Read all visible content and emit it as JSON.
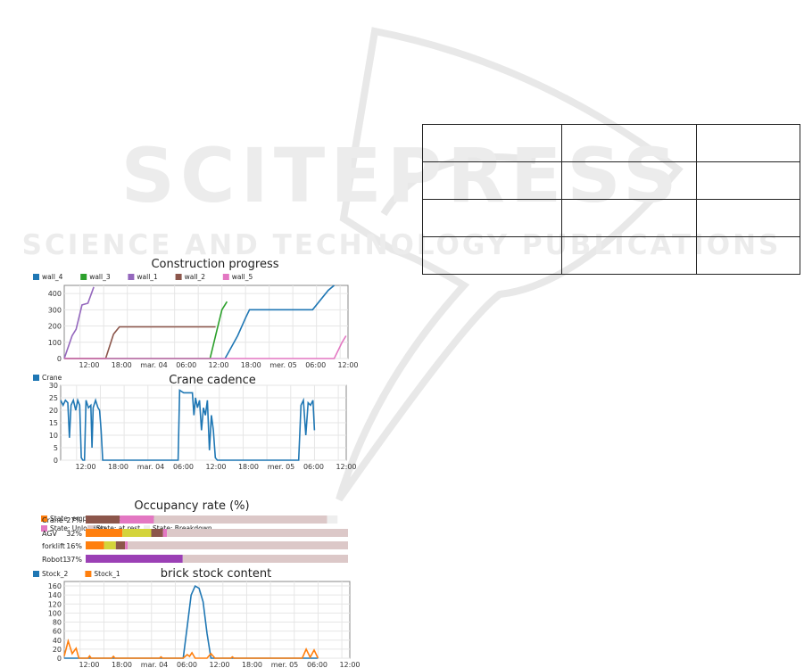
{
  "watermark": {
    "line1": "SCITEPRESS",
    "line2": "SCIENCE AND TECHNOLOGY PUBLICATIONS"
  },
  "empty_table": {
    "rows": 4,
    "cols": 3
  },
  "colors": {
    "wall_4": "#1f77b4",
    "wall_3": "#2ca02c",
    "wall_1": "#9467bd",
    "wall_2": "#8c564b",
    "wall_5": "#e377c2",
    "crane": "#1f77b4",
    "stock_2": "#1f77b4",
    "stock_1": "#ff7f0e"
  },
  "chart_data": [
    {
      "type": "line",
      "title": "Construction progress",
      "x_ticks": [
        "12:00",
        "18:00",
        "mar. 04",
        "06:00",
        "12:00",
        "18:00",
        "mer. 05",
        "06:00",
        "12:00"
      ],
      "ylim": [
        0,
        450
      ],
      "y_ticks": [
        0,
        100,
        200,
        300,
        400
      ],
      "series": [
        {
          "name": "wall_4",
          "points": [
            [
              0,
              0
            ],
            [
              40.8,
              0
            ],
            [
              41.5,
              30
            ],
            [
              44,
              140
            ],
            [
              46,
              250
            ],
            [
              47,
              300
            ],
            [
              63,
              300
            ],
            [
              67,
              420
            ],
            [
              68.5,
              450
            ]
          ]
        },
        {
          "name": "wall_3",
          "points": [
            [
              0,
              0
            ],
            [
              37,
              0
            ],
            [
              38.5,
              150
            ],
            [
              40,
              300
            ],
            [
              41.3,
              350
            ]
          ]
        },
        {
          "name": "wall_1",
          "points": [
            [
              0,
              0
            ],
            [
              2,
              140
            ],
            [
              3,
              180
            ],
            [
              4.5,
              330
            ],
            [
              6,
              340
            ],
            [
              7.5,
              440
            ]
          ]
        },
        {
          "name": "wall_2",
          "points": [
            [
              0,
              0
            ],
            [
              10.5,
              0
            ],
            [
              12.5,
              150
            ],
            [
              14,
              195
            ],
            [
              38.4,
              195
            ]
          ]
        },
        {
          "name": "wall_5",
          "points": [
            [
              0,
              0
            ],
            [
              68.5,
              0
            ],
            [
              70.5,
              100
            ],
            [
              71.5,
              140
            ]
          ]
        }
      ],
      "grid": true,
      "legend": "top-left"
    },
    {
      "type": "line",
      "title": "Crane cadence",
      "x_ticks": [
        "12:00",
        "18:00",
        "mar. 04",
        "06:00",
        "12:00",
        "18:00",
        "mer. 05",
        "06:00",
        "12:00"
      ],
      "ylim": [
        0,
        30
      ],
      "y_ticks": [
        0,
        5,
        10,
        15,
        20,
        25,
        30
      ],
      "series": [
        {
          "name": "Crane",
          "points": [
            [
              0,
              24
            ],
            [
              0.6,
              22
            ],
            [
              1.2,
              24
            ],
            [
              1.8,
              23
            ],
            [
              2.2,
              9
            ],
            [
              2.6,
              22
            ],
            [
              3.2,
              24
            ],
            [
              3.8,
              20
            ],
            [
              4.3,
              24
            ],
            [
              4.8,
              22
            ],
            [
              5.2,
              1
            ],
            [
              5.6,
              0
            ],
            [
              6,
              0
            ],
            [
              6.4,
              24
            ],
            [
              7,
              21
            ],
            [
              7.6,
              22
            ],
            [
              7.9,
              5
            ],
            [
              8.2,
              21
            ],
            [
              8.8,
              24
            ],
            [
              9.4,
              21
            ],
            [
              9.8,
              20
            ],
            [
              10.2,
              12
            ],
            [
              10.6,
              0
            ],
            [
              11.2,
              0
            ],
            [
              29.6,
              0
            ],
            [
              30,
              28
            ],
            [
              31,
              27
            ],
            [
              32,
              27
            ],
            [
              33.2,
              27
            ],
            [
              33.6,
              18
            ],
            [
              34,
              25
            ],
            [
              34.5,
              21
            ],
            [
              35,
              24
            ],
            [
              35.5,
              12
            ],
            [
              36,
              21
            ],
            [
              36.5,
              18
            ],
            [
              37,
              24
            ],
            [
              37.5,
              4
            ],
            [
              38,
              18
            ],
            [
              38.5,
              12
            ],
            [
              39,
              1
            ],
            [
              39.5,
              0
            ],
            [
              60,
              0
            ],
            [
              60.6,
              22
            ],
            [
              61.2,
              24
            ],
            [
              61.8,
              10
            ],
            [
              62.4,
              23
            ],
            [
              63,
              22
            ],
            [
              63.6,
              24
            ],
            [
              64,
              12
            ]
          ]
        }
      ],
      "grid": true,
      "legend": "top-left"
    },
    {
      "type": "bar",
      "stacked": true,
      "orientation": "horizontal",
      "title": "Occupancy rate (%)",
      "legend": "top-left",
      "states": [
        {
          "name": "State: empty travel",
          "color": "#ff7f0e"
        },
        {
          "name": "State: charged travel",
          "color": "#d4d43b"
        },
        {
          "name": "State: Loading",
          "color": "#8c564b"
        },
        {
          "name": "State: Surface finish",
          "color": "#9b40b5"
        },
        {
          "name": "State: Unloading",
          "color": "#e377c2"
        },
        {
          "name": "State: at rest",
          "color": "#dcc8c8"
        },
        {
          "name": "State: Breakdown",
          "color": "#eeeeee"
        }
      ],
      "categories": [
        {
          "name": "Crane",
          "rate": "27%",
          "segments": [
            [
              2,
              13.0
            ],
            [
              4,
              13.0
            ],
            [
              5,
              66.0
            ],
            [
              6,
              4.0
            ]
          ]
        },
        {
          "name": "AGV",
          "rate": "32%",
          "segments": [
            [
              0,
              14.0
            ],
            [
              1,
              11.0
            ],
            [
              2,
              4.5
            ],
            [
              4,
              1.5
            ],
            [
              5,
              69.0
            ]
          ]
        },
        {
          "name": "forklift",
          "rate": "16%",
          "segments": [
            [
              0,
              7.0
            ],
            [
              1,
              4.5
            ],
            [
              2,
              3.5
            ],
            [
              4,
              1.0
            ],
            [
              5,
              84.0
            ]
          ]
        },
        {
          "name": "Robot1",
          "rate": "37%",
          "segments": [
            [
              3,
              37.0
            ],
            [
              5,
              63.0
            ]
          ]
        }
      ]
    },
    {
      "type": "line",
      "title": "brick stock content",
      "x_ticks": [
        "12:00",
        "18:00",
        "mar. 04",
        "06:00",
        "12:00",
        "18:00",
        "mer. 05",
        "06:00",
        "12:00"
      ],
      "ylim": [
        0,
        170
      ],
      "y_ticks": [
        0,
        20,
        40,
        60,
        80,
        100,
        120,
        140,
        160
      ],
      "series": [
        {
          "name": "Stock_2",
          "points": [
            [
              0,
              0
            ],
            [
              30,
              0
            ],
            [
              31,
              70
            ],
            [
              32,
              140
            ],
            [
              33,
              160
            ],
            [
              34,
              155
            ],
            [
              35,
              125
            ],
            [
              36,
              55
            ],
            [
              37,
              0
            ],
            [
              64,
              0
            ]
          ]
        },
        {
          "name": "Stock_1",
          "points": [
            [
              0,
              5
            ],
            [
              1,
              38
            ],
            [
              2,
              10
            ],
            [
              3,
              22
            ],
            [
              3.7,
              0
            ],
            [
              6,
              0
            ],
            [
              6.4,
              5
            ],
            [
              6.8,
              0
            ],
            [
              12,
              0
            ],
            [
              12.4,
              4
            ],
            [
              12.8,
              0
            ],
            [
              24,
              0
            ],
            [
              24.4,
              3
            ],
            [
              24.8,
              0
            ],
            [
              30,
              0
            ],
            [
              31,
              8
            ],
            [
              31.6,
              4
            ],
            [
              32.2,
              12
            ],
            [
              33,
              0
            ],
            [
              36,
              0
            ],
            [
              37,
              10
            ],
            [
              38,
              0
            ],
            [
              42,
              0
            ],
            [
              42.4,
              3
            ],
            [
              42.8,
              0
            ],
            [
              60,
              0
            ],
            [
              61,
              20
            ],
            [
              62,
              2
            ],
            [
              63,
              18
            ],
            [
              64,
              0
            ]
          ]
        }
      ],
      "grid": true,
      "legend": "top-left"
    }
  ]
}
